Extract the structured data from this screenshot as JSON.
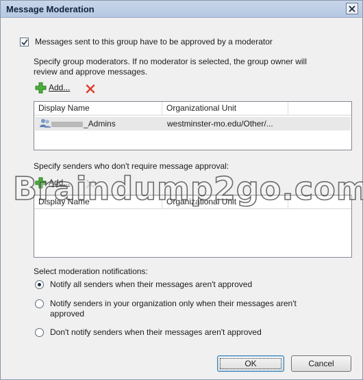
{
  "window": {
    "title": "Message Moderation"
  },
  "moderation": {
    "require_approval_label": "Messages sent to this group have to be approved by a moderator",
    "require_approval_checked": true,
    "moderators_description_line1": "Specify group moderators. If no moderator is selected, the group owner will",
    "moderators_description_line2": "review and approve messages.",
    "add_label": "Add...",
    "columns": [
      "Display Name",
      "Organizational Unit"
    ],
    "moderators": [
      {
        "display_name": "_Admins",
        "organizational_unit": "westminster-mo.edu/Other/..."
      }
    ]
  },
  "senders": {
    "description": "Specify senders who don't require message approval:",
    "add_label": "Add...",
    "columns": [
      "Display Name",
      "Organizational Unit"
    ],
    "items": []
  },
  "notifications": {
    "heading": "Select moderation notifications:",
    "options": [
      {
        "line1": "Notify all senders when their messages aren't approved",
        "line2": "",
        "selected": true
      },
      {
        "line1": "Notify senders in your organization only when their messages aren't",
        "line2": "approved",
        "selected": false
      },
      {
        "line1": "Don't notify senders when their messages aren't approved",
        "line2": "",
        "selected": false
      }
    ]
  },
  "buttons": {
    "ok": "OK",
    "cancel": "Cancel"
  },
  "watermark": "Braindump2go.com",
  "icons": {
    "add": "add-green-plus-icon",
    "remove": "remove-red-x-icon",
    "group": "group-users-icon",
    "close": "close-icon",
    "check": "checkmark-icon"
  }
}
